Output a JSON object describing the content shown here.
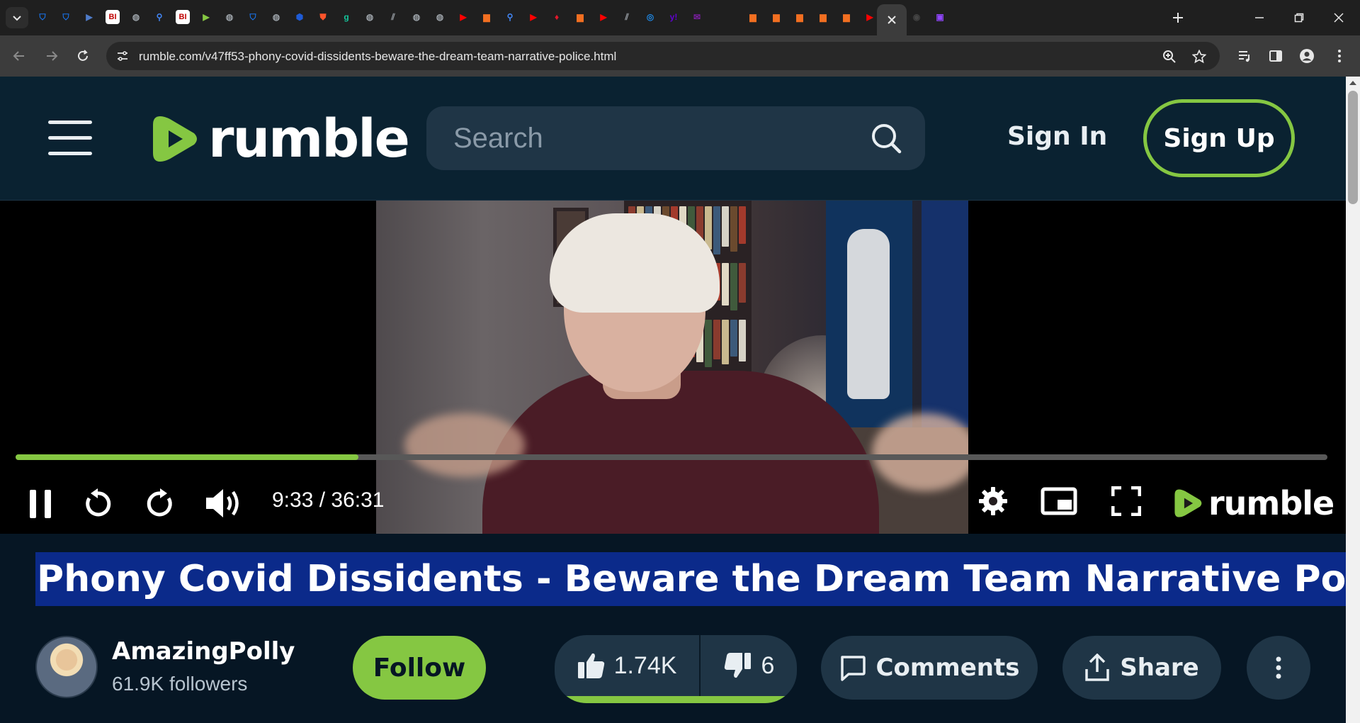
{
  "browser": {
    "url": "rumble.com/v47ff53-phony-covid-dissidents-beware-the-dream-team-narrative-police.html",
    "tab_favicons": [
      {
        "name": "favicon-shield",
        "color": "#1a73e8",
        "glyph": "⛉"
      },
      {
        "name": "favicon-shield",
        "color": "#1a73e8",
        "glyph": "⛉"
      },
      {
        "name": "favicon-arrow",
        "color": "#4f7cc9",
        "glyph": "▶"
      },
      {
        "name": "favicon-bi",
        "color": "#c00000",
        "glyph": "BI"
      },
      {
        "name": "favicon-globe",
        "color": "#9aa0a6",
        "glyph": "◍"
      },
      {
        "name": "favicon-search",
        "color": "#4285f4",
        "glyph": "⚲"
      },
      {
        "name": "favicon-bi",
        "color": "#c00000",
        "glyph": "BI"
      },
      {
        "name": "favicon-rumble",
        "color": "#85c742",
        "glyph": "▶"
      },
      {
        "name": "favicon-globe",
        "color": "#9aa0a6",
        "glyph": "◍"
      },
      {
        "name": "favicon-shield",
        "color": "#1a73e8",
        "glyph": "⛉"
      },
      {
        "name": "favicon-globe",
        "color": "#9aa0a6",
        "glyph": "◍"
      },
      {
        "name": "favicon-hex",
        "color": "#1e5bd6",
        "glyph": "⬢"
      },
      {
        "name": "favicon-brave",
        "color": "#fb542b",
        "glyph": "⛊"
      },
      {
        "name": "favicon-g",
        "color": "#15c39a",
        "glyph": "g"
      },
      {
        "name": "favicon-globe",
        "color": "#9aa0a6",
        "glyph": "◍"
      },
      {
        "name": "favicon-slash",
        "color": "#9aa0a6",
        "glyph": "⫽"
      },
      {
        "name": "favicon-globe",
        "color": "#9aa0a6",
        "glyph": "◍"
      },
      {
        "name": "favicon-globe",
        "color": "#9aa0a6",
        "glyph": "◍"
      },
      {
        "name": "favicon-youtube",
        "color": "#ff0000",
        "glyph": "▶"
      },
      {
        "name": "favicon-bookmark",
        "color": "#f26f21",
        "glyph": "▆"
      },
      {
        "name": "favicon-search",
        "color": "#4285f4",
        "glyph": "⚲"
      },
      {
        "name": "favicon-youtube",
        "color": "#ff0000",
        "glyph": "▶"
      },
      {
        "name": "favicon-red",
        "color": "#e2182b",
        "glyph": "♦"
      },
      {
        "name": "favicon-bookmark",
        "color": "#f26f21",
        "glyph": "▆"
      },
      {
        "name": "favicon-youtube",
        "color": "#ff0000",
        "glyph": "▶"
      },
      {
        "name": "favicon-slash",
        "color": "#9aa0a6",
        "glyph": "⫽"
      },
      {
        "name": "favicon-circle",
        "color": "#1e88e5",
        "glyph": "◎"
      },
      {
        "name": "favicon-yahoo",
        "color": "#6001d2",
        "glyph": "y!"
      },
      {
        "name": "favicon-mail",
        "color": "#7b1fa2",
        "glyph": "✉"
      },
      {
        "name": "favicon-bookmark",
        "color": "#f26f21",
        "glyph": "▆"
      },
      {
        "name": "favicon-bookmark",
        "color": "#f26f21",
        "glyph": "▆"
      },
      {
        "name": "favicon-bookmark",
        "color": "#f26f21",
        "glyph": "▆"
      },
      {
        "name": "favicon-bookmark",
        "color": "#f26f21",
        "glyph": "▆"
      },
      {
        "name": "favicon-bookmark",
        "color": "#f26f21",
        "glyph": "▆"
      },
      {
        "name": "favicon-youtube",
        "color": "#ff0000",
        "glyph": "▶"
      },
      {
        "name": "favicon-r",
        "color": "#ffffff",
        "glyph": "R"
      },
      {
        "name": "favicon-dark",
        "color": "#444444",
        "glyph": "◉"
      },
      {
        "name": "favicon-twitch",
        "color": "#9146ff",
        "glyph": "▣"
      }
    ]
  },
  "header": {
    "logo_text": "rumble",
    "search_placeholder": "Search",
    "sign_in": "Sign In",
    "sign_up": "Sign Up",
    "accent": "#85c742"
  },
  "player": {
    "current_time": "9:33",
    "duration": "36:31",
    "time_display": "9:33 / 36:31",
    "progress_fraction": 0.2615,
    "logo_text": "rumble"
  },
  "video": {
    "title": "Phony Covid Dissidents - Beware the Dream Team Narrative Police",
    "channel_name": "AmazingPolly",
    "followers": "61.9K followers",
    "follow_label": "Follow",
    "likes": "1.74K",
    "dislikes": "6",
    "comments_label": "Comments",
    "share_label": "Share"
  }
}
